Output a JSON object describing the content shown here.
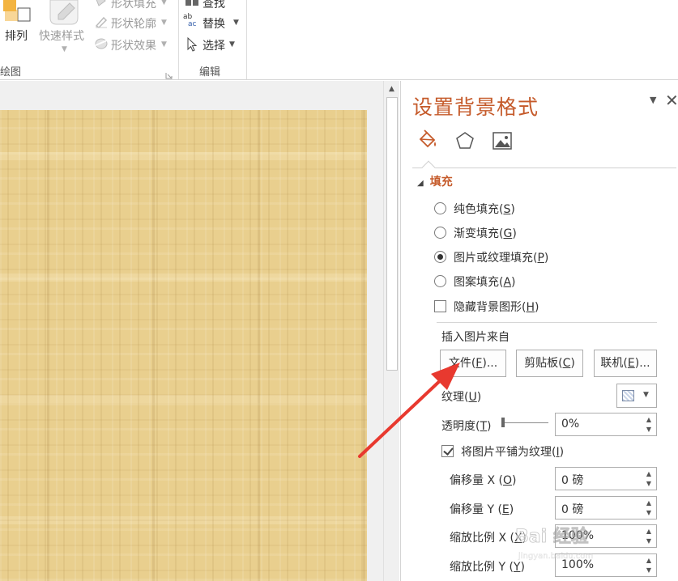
{
  "ribbon": {
    "arrange_label": "排列",
    "quick_style_label": "快速样式",
    "shape_fill_label": "形状填充",
    "shape_outline_label": "形状轮廓",
    "shape_effects_label": "形状效果",
    "drawing_group": "绘图",
    "find_label": "查找",
    "replace_label": "替换",
    "select_label": "选择",
    "editing_group": "编辑"
  },
  "pane": {
    "title": "设置背景格式",
    "tabs": [
      {
        "icon": "paint-bucket-icon",
        "label": ""
      },
      {
        "icon": "pentagon-icon",
        "label": ""
      },
      {
        "icon": "picture-icon",
        "label": ""
      }
    ],
    "fill": {
      "header": "填充",
      "options": [
        {
          "text": "纯色填充(",
          "key": "S",
          "end": ")",
          "selected": false
        },
        {
          "text": "渐变填充(",
          "key": "G",
          "end": ")",
          "selected": false
        },
        {
          "text": "图片或纹理填充(",
          "key": "P",
          "end": ")",
          "selected": true
        },
        {
          "text": "图案填充(",
          "key": "A",
          "end": ")",
          "selected": false
        }
      ],
      "hide_bg": {
        "text": "隐藏背景图形(",
        "key": "H",
        "end": ")",
        "checked": false
      }
    },
    "insert_from": "插入图片来自",
    "buttons": {
      "file": {
        "text": "文件(",
        "key": "F",
        "end": ")..."
      },
      "clipboard": {
        "text": "剪贴板(",
        "key": "C",
        "end": ")"
      },
      "online": {
        "text": "联机(",
        "key": "E",
        "end": ")..."
      }
    },
    "texture": {
      "text": "纹理(",
      "key": "U",
      "end": ")"
    },
    "transparency": {
      "text": "透明度(",
      "key": "T",
      "end": ")",
      "value": "0%"
    },
    "tile": {
      "text": "将图片平铺为纹理(",
      "key": "I",
      "end": ")",
      "checked": true
    },
    "offset_x": {
      "text": "偏移量 X (",
      "key": "O",
      "end": ")",
      "value": "0 磅"
    },
    "offset_y": {
      "text": "偏移量 Y (",
      "key": "E",
      "end": ")",
      "value": "0 磅"
    },
    "scale_x": {
      "text": "缩放比例 X (",
      "key": "X",
      "end": ")",
      "value": "100%"
    },
    "scale_y": {
      "text": "缩放比例 Y (",
      "key": "Y",
      "end": ")",
      "value": "100%"
    }
  },
  "watermark": {
    "text": "Bai 经验",
    "sub": "jingyan.baidu.com"
  },
  "colors": {
    "accent": "#c55a2a",
    "slide": "#e9cf8e",
    "arrow": "#e8392f"
  }
}
